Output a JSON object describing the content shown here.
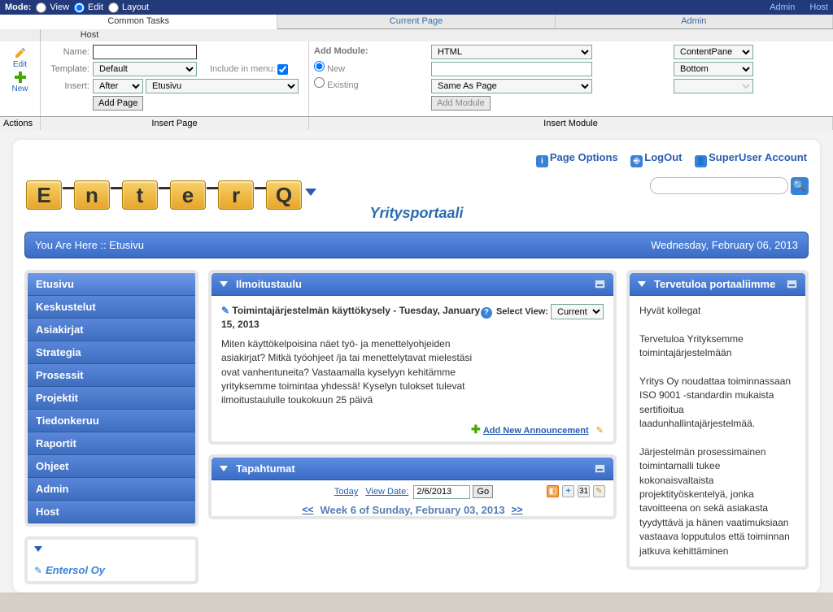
{
  "topbar": {
    "mode_label": "Mode:",
    "view": "View",
    "edit": "Edit",
    "layout": "Layout",
    "admin_link": "Admin",
    "host_link": "Host"
  },
  "tabs": {
    "common": "Common Tasks",
    "current": "Current Page",
    "admin": "Admin",
    "host": "Host"
  },
  "actions": {
    "edit": "Edit",
    "new": "New",
    "label": "Actions"
  },
  "insert_page": {
    "section": "Insert Page",
    "name_label": "Name:",
    "name_value": "",
    "template_label": "Template:",
    "template_value": "Default",
    "include_menu": "Include in menu:",
    "insert_label": "Insert:",
    "insert_pos": "After",
    "insert_ref": "Etusivu",
    "add_page_btn": "Add Page"
  },
  "insert_module": {
    "section": "Insert Module",
    "add_module_label": "Add Module:",
    "new": "New",
    "existing": "Existing",
    "type": "HTML",
    "title": "",
    "perm": "Same As Page",
    "pane": "ContentPane",
    "pos": "Bottom",
    "align": "",
    "add_btn": "Add Module"
  },
  "portal": {
    "title": "Yritysportaali",
    "page_options": "Page Options",
    "logout": "LogOut",
    "account": "SuperUser Account",
    "breadcrumb": "You Are Here :: Etusivu",
    "date": "Wednesday, February 06, 2013"
  },
  "nav": [
    "Etusivu",
    "Keskustelut",
    "Asiakirjat",
    "Strategia",
    "Prosessit",
    "Projektit",
    "Tiedonkeruu",
    "Raportit",
    "Ohjeet",
    "Admin",
    "Host"
  ],
  "mini": {
    "title": "Entersol Oy"
  },
  "ilmoitus": {
    "title": "Ilmoitustaulu",
    "select_view_label": "Select View:",
    "select_view_value": "Current",
    "ann_title": "Toimintajärjestelmän käyttökysely - Tuesday, January 15, 2013",
    "ann_body": "Miten käyttökelpoisina näet työ- ja menettelyohjeiden asiakirjat? Mitkä työohjeet /ja tai menettelytavat mielestäsi ovat vanhentuneita? Vastaamalla kyselyyn kehitämme yrityksemme toimintaa yhdessä! Kyselyn tulokset tulevat ilmoitustaululle toukokuun 25 päivä",
    "add_new": "Add New Announcement"
  },
  "tapahtumat": {
    "title": "Tapahtumat",
    "today": "Today",
    "view_date": "View Date:",
    "date_value": "2/6/2013",
    "go": "Go",
    "prev": "<<",
    "week": "Week 6 of Sunday, February 03, 2013",
    "next": ">>"
  },
  "welcome": {
    "title": "Tervetuloa portaaliimme",
    "p1": "Hyvät kollegat",
    "p2": "Tervetuloa Yrityksemme toimintajärjestelmään",
    "p3": "Yritys Oy noudattaa toiminnassaan ISO 9001 -standardin mukaista sertifioitua laadunhallintajärjestelmää.",
    "p4": "Järjestelmän prosessimainen toimintamalli tukee kokonaisvaltaista projektityöskentelyä, jonka tavoitteena on sekä asiakasta tyydyttävä ja hänen vaatimuksiaan vastaava lopputulos että toiminnan jatkuva kehittäminen"
  }
}
